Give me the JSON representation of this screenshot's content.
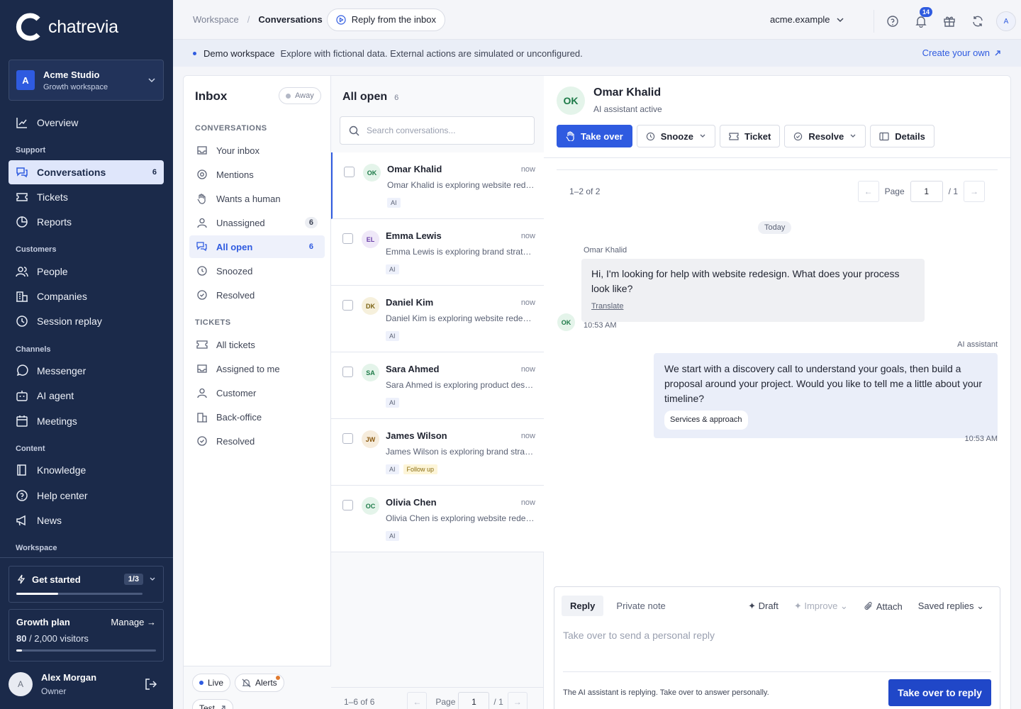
{
  "app": {
    "name": "chatrevia"
  },
  "workspace": {
    "name": "Acme Studio",
    "plan": "Growth workspace",
    "initial": "A"
  },
  "nav": {
    "overview": "Overview",
    "sections": {
      "support": "Support",
      "customers": "Customers",
      "channels": "Channels",
      "content": "Content",
      "workspace": "Workspace"
    },
    "items": {
      "conversations": {
        "label": "Conversations",
        "badge": "6"
      },
      "tickets": "Tickets",
      "reports": "Reports",
      "people": "People",
      "companies": "Companies",
      "session_replay": "Session replay",
      "messenger": "Messenger",
      "ai_agent": "AI agent",
      "meetings": "Meetings",
      "knowledge": "Knowledge",
      "help_center": "Help center",
      "news": "News"
    }
  },
  "get_started": {
    "label": "Get started",
    "count": "1/3",
    "progress": 0.33
  },
  "growth_plan": {
    "label": "Growth plan",
    "manage": "Manage →",
    "used": "80",
    "limit": " / 2,000 visitors",
    "progress": 0.04
  },
  "user": {
    "name": "Alex Morgan",
    "role": "Owner",
    "initial": "A"
  },
  "topbar": {
    "crumbs": [
      "Workspace",
      "/",
      "Conversations"
    ],
    "pill": "Reply from the inbox",
    "domain": "acme.example",
    "notifications": "14",
    "avatar": "A"
  },
  "banner": {
    "title": "Demo workspace",
    "text": "Explore with fictional data. External actions are simulated or unconfigured.",
    "link": "Create your own"
  },
  "inbox": {
    "title": "Inbox",
    "status": "Away",
    "conversations_header": "CONVERSATIONS",
    "conv_items": [
      {
        "label": "Your inbox",
        "badge": ""
      },
      {
        "label": "Mentions",
        "badge": ""
      },
      {
        "label": "Wants a human",
        "badge": ""
      },
      {
        "label": "Unassigned",
        "badge": "6"
      },
      {
        "label": "All open",
        "badge": "6"
      },
      {
        "label": "Snoozed",
        "badge": ""
      },
      {
        "label": "Resolved",
        "badge": ""
      }
    ],
    "tickets_header": "TICKETS",
    "ticket_items": [
      "All tickets",
      "Assigned to me",
      "Customer",
      "Back-office",
      "Resolved"
    ],
    "footer": {
      "live": "Live",
      "alerts": "Alerts",
      "test": "Test"
    }
  },
  "list": {
    "title": "All open",
    "count": "6",
    "search_placeholder": "Search conversations...",
    "items": [
      {
        "initials": "OK",
        "name": "Omar Khalid",
        "time": "now",
        "preview": "Omar Khalid is exploring website redesign.",
        "tags": [
          "AI"
        ],
        "avatar_bg": "#e4f4ea",
        "avatar_fg": "#1d7a48"
      },
      {
        "initials": "EL",
        "name": "Emma Lewis",
        "time": "now",
        "preview": "Emma Lewis is exploring brand strategy.",
        "tags": [
          "AI"
        ],
        "avatar_bg": "#efe8f8",
        "avatar_fg": "#6a3fa8"
      },
      {
        "initials": "DK",
        "name": "Daniel Kim",
        "time": "now",
        "preview": "Daniel Kim is exploring website redesign.",
        "tags": [
          "AI"
        ],
        "avatar_bg": "#f6f0dc",
        "avatar_fg": "#7a6212"
      },
      {
        "initials": "SA",
        "name": "Sara Ahmed",
        "time": "now",
        "preview": "Sara Ahmed is exploring product design.",
        "tags": [
          "AI"
        ],
        "avatar_bg": "#e4f4ea",
        "avatar_fg": "#1d7a48"
      },
      {
        "initials": "JW",
        "name": "James Wilson",
        "time": "now",
        "preview": "James Wilson is exploring brand strategy.",
        "tags": [
          "AI",
          "Follow up"
        ],
        "avatar_bg": "#f6ecdc",
        "avatar_fg": "#8a5a12"
      },
      {
        "initials": "OC",
        "name": "Olivia Chen",
        "time": "now",
        "preview": "Olivia Chen is exploring website redesign.",
        "tags": [
          "AI"
        ],
        "avatar_bg": "#e4f4ea",
        "avatar_fg": "#1d7a48"
      }
    ],
    "footer": {
      "range": "1–6 of 6",
      "page_label": "Page",
      "page": "1",
      "total": "/ 1"
    }
  },
  "detail": {
    "initials": "OK",
    "name": "Omar Khalid",
    "status": "AI assistant active",
    "actions": {
      "take_over": "Take over",
      "snooze": "Snooze",
      "ticket": "Ticket",
      "resolve": "Resolve",
      "details": "Details"
    },
    "pager": {
      "range": "1–2 of 2",
      "page_label": "Page",
      "page": "1",
      "total": "/ 1"
    },
    "day": "Today",
    "incoming": {
      "author": "Omar Khalid",
      "text": "Hi, I'm looking for help with website redesign. What does your process look like?",
      "translate": "Translate",
      "time": "10:53 AM"
    },
    "outgoing": {
      "author": "AI assistant",
      "text": "We start with a discovery call to understand your goals, then build a proposal around your project. Would you like to tell me a little about your timeline?",
      "tag": "Services & approach",
      "time": "10:53 AM"
    },
    "composer": {
      "tab_reply": "Reply",
      "tab_note": "Private note",
      "draft": "✦ Draft",
      "improve": "✦ Improve",
      "attach": "Attach",
      "saved": "Saved replies",
      "placeholder": "Take over to send a personal reply",
      "note": "The AI assistant is replying. Take over to answer personally.",
      "send": "Take over to reply"
    }
  },
  "colors": {
    "sidebar": "#1b2a4a",
    "accent": "#2f5be0",
    "active_nav": "#dfe6fb"
  }
}
